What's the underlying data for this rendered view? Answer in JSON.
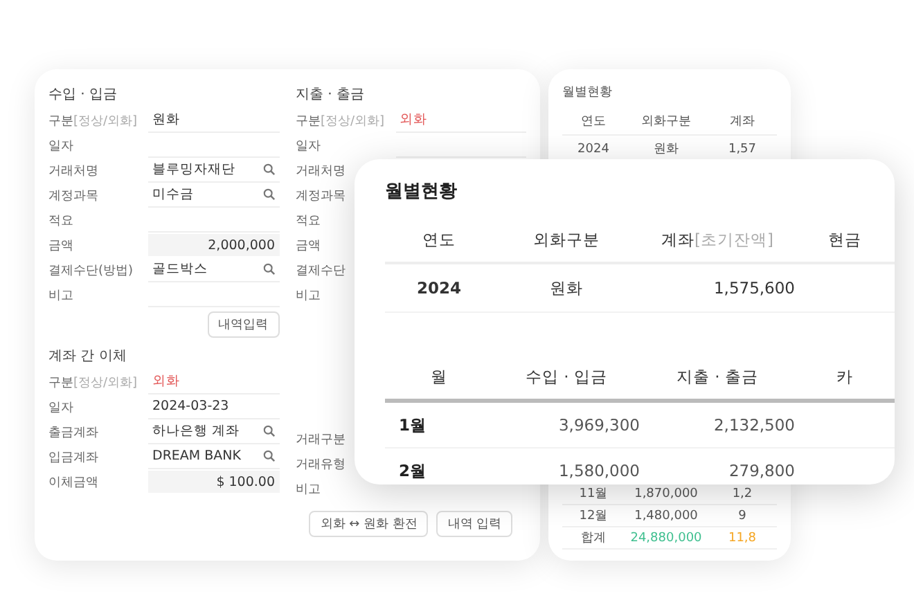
{
  "income": {
    "title": "수입 · 입금",
    "fields": [
      {
        "label": "구분",
        "hint": "[정상/외화]",
        "value": "원화",
        "kind": "text"
      },
      {
        "label": "일자",
        "kind": "text"
      },
      {
        "label": "거래처명",
        "value": "블루밍자재단",
        "kind": "search"
      },
      {
        "label": "계정과목",
        "value": "미수금",
        "kind": "search"
      },
      {
        "label": "적요",
        "kind": "text"
      },
      {
        "label": "금액",
        "value": "2,000,000",
        "kind": "amount"
      },
      {
        "label": "결제수단(방법)",
        "value": "골드박스",
        "kind": "search"
      },
      {
        "label": "비고",
        "kind": "text"
      }
    ],
    "button": "내역입력"
  },
  "transfer": {
    "title": "계좌 간 이체",
    "fields": [
      {
        "label": "구분",
        "hint": "[정상/외화]",
        "value": "외화",
        "kind": "tag"
      },
      {
        "label": "일자",
        "value": "2024-03-23",
        "kind": "text"
      },
      {
        "label": "출금계좌",
        "value": "하나은행 계좌",
        "kind": "search"
      },
      {
        "label": "입금계좌",
        "value": "DREAM BANK",
        "kind": "search"
      },
      {
        "label": "이체금액",
        "value": "$ 100.00",
        "kind": "amount"
      }
    ]
  },
  "expense": {
    "title": "지출 · 출금",
    "fields": [
      {
        "label": "구분",
        "hint": "[정상/외화]",
        "value": "외화",
        "kind": "tag"
      },
      {
        "label": "일자",
        "kind": "text"
      },
      {
        "label": "거래처명"
      },
      {
        "label": "계정과목"
      },
      {
        "label": "적요"
      },
      {
        "label": "금액"
      },
      {
        "label": "결제수단"
      },
      {
        "label": "비고"
      }
    ],
    "lower_fields": [
      {
        "label": "거래구분"
      },
      {
        "label": "거래유형"
      },
      {
        "label": "비고"
      }
    ],
    "buttons": [
      "외화 ↔ 원화 환전",
      "내역 입력"
    ]
  },
  "mini_summary": {
    "title": "월별현황",
    "columns": [
      "연도",
      "외화구분",
      "계좌"
    ],
    "rows": [
      {
        "cells": [
          {
            "text": "2024"
          },
          {
            "text": "원화"
          },
          {
            "text": "1,57"
          }
        ]
      }
    ],
    "bottom_rows": [
      {
        "cells": [
          {
            "text": "11월"
          },
          {
            "text": "1,870,000"
          },
          {
            "text": "1,2"
          }
        ]
      },
      {
        "cells": [
          {
            "text": "12월"
          },
          {
            "text": "1,480,000"
          },
          {
            "text": "9"
          }
        ]
      },
      {
        "cells": [
          {
            "text": "합계"
          },
          {
            "text": "24,880,000",
            "color": "#3fbf8f"
          },
          {
            "text": "11,8",
            "color": "#f5a623"
          }
        ]
      }
    ]
  },
  "monthly_status": {
    "title": "월별현황",
    "year_table": {
      "columns": [
        {
          "label": "연도"
        },
        {
          "label": "외화구분"
        },
        {
          "label": "계좌",
          "hint": "[초기잔액]"
        },
        {
          "label": "현금"
        }
      ],
      "rows": [
        [
          "2024",
          "원화",
          "1,575,600"
        ]
      ]
    },
    "month_table": {
      "columns": [
        "월",
        "수입 · 입금",
        "지출 · 출금",
        "카"
      ],
      "rows": [
        [
          "1월",
          "3,969,300",
          "2,132,500"
        ],
        [
          "2월",
          "1,580,000",
          "279,800"
        ]
      ]
    }
  }
}
